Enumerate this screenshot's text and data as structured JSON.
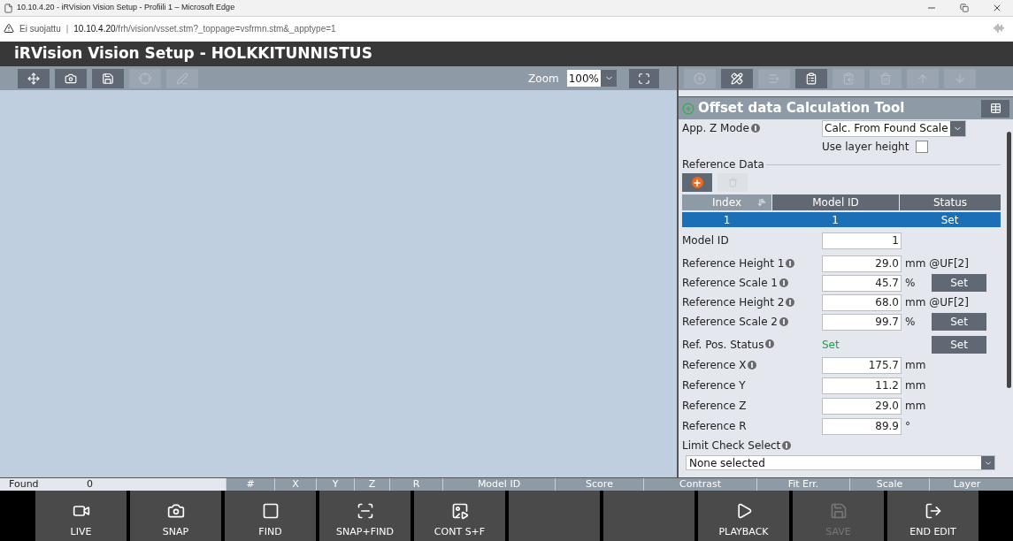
{
  "browser": {
    "title": "10.10.4.20 - iRVision Vision Setup - Profiili 1 – Microsoft Edge",
    "security": "Ei suojattu",
    "separator": "|",
    "url_host": "10.10.4.20",
    "url_path": "/frh/vision/vsset.stm?_toppage=vsfrmn.stm&_apptype=1"
  },
  "app_title": "iRVision Vision Setup - HOLKKITUNNISTUS",
  "left_toolbar": [
    {
      "kind": "move",
      "disabled": false
    },
    {
      "kind": "camera-back",
      "disabled": false
    },
    {
      "kind": "camera-save",
      "disabled": false
    },
    {
      "kind": "target",
      "disabled": true
    },
    {
      "kind": "pen",
      "disabled": true
    }
  ],
  "zoom": {
    "label": "Zoom",
    "value": "100%"
  },
  "right_toolbar": [
    {
      "kind": "add",
      "disabled": true
    },
    {
      "kind": "edit",
      "disabled": false
    },
    {
      "kind": "list-import",
      "disabled": true
    },
    {
      "kind": "clip",
      "disabled": false
    },
    {
      "kind": "clip-back",
      "disabled": true
    },
    {
      "kind": "trash",
      "disabled": true
    },
    {
      "kind": "up",
      "disabled": true
    },
    {
      "kind": "down",
      "disabled": true
    }
  ],
  "panel": {
    "title": "Offset data Calculation Tool",
    "app_z_mode": {
      "label": "App. Z Mode",
      "value": "Calc. From Found Scale"
    },
    "use_layer_height": {
      "label": "Use layer height",
      "checked": false
    },
    "reference_data": {
      "label": "Reference Data",
      "columns": [
        "Index",
        "Model ID",
        "Status"
      ],
      "rows": [
        {
          "cells": [
            "1",
            "1",
            "Set"
          ],
          "selected": true
        }
      ]
    },
    "model_id": {
      "label": "Model ID",
      "value": "1"
    },
    "fields": [
      {
        "label": "Reference Height 1",
        "info": true,
        "value": "29.0",
        "unit": "mm @UF[2]"
      },
      {
        "label": "Reference Scale 1",
        "info": true,
        "value": "45.7",
        "unit": "%",
        "button": "Set"
      },
      {
        "label": "Reference Height 2",
        "info": true,
        "value": "68.0",
        "unit": "mm @UF[2]"
      },
      {
        "label": "Reference Scale 2",
        "info": true,
        "value": "99.7",
        "unit": "%",
        "button": "Set"
      }
    ],
    "ref_pos_status": {
      "label": "Ref. Pos. Status",
      "value": "Set",
      "button": "Set"
    },
    "positions": [
      {
        "label": "Reference X",
        "info": true,
        "value": "175.7",
        "unit": "mm"
      },
      {
        "label": "Reference Y",
        "info": false,
        "value": "11.2",
        "unit": "mm"
      },
      {
        "label": "Reference Z",
        "info": false,
        "value": "29.0",
        "unit": "mm"
      },
      {
        "label": "Reference R",
        "info": false,
        "value": "89.9",
        "unit": "°"
      }
    ],
    "limit_check": {
      "label": "Limit Check Select",
      "value": "None selected"
    }
  },
  "results": {
    "found_label": "Found",
    "found_value": "0",
    "columns": [
      "#",
      "X",
      "Y",
      "Z",
      "R",
      "Model ID",
      "Score",
      "Contrast",
      "Fit Err.",
      "Scale",
      "Layer"
    ]
  },
  "buttons": [
    {
      "kind": "live",
      "label": "LIVE",
      "disabled": false
    },
    {
      "kind": "snap",
      "label": "SNAP",
      "disabled": false
    },
    {
      "kind": "find",
      "label": "FIND",
      "disabled": false
    },
    {
      "kind": "snap-find",
      "label": "SNAP+FIND",
      "disabled": false
    },
    {
      "kind": "cont",
      "label": "CONT S+F",
      "disabled": false
    },
    {
      "kind": "blank"
    },
    {
      "kind": "blank"
    },
    {
      "kind": "playback",
      "label": "PLAYBACK",
      "disabled": false
    },
    {
      "kind": "save",
      "label": "SAVE",
      "disabled": true
    },
    {
      "kind": "end",
      "label": "END EDIT",
      "disabled": false
    }
  ]
}
